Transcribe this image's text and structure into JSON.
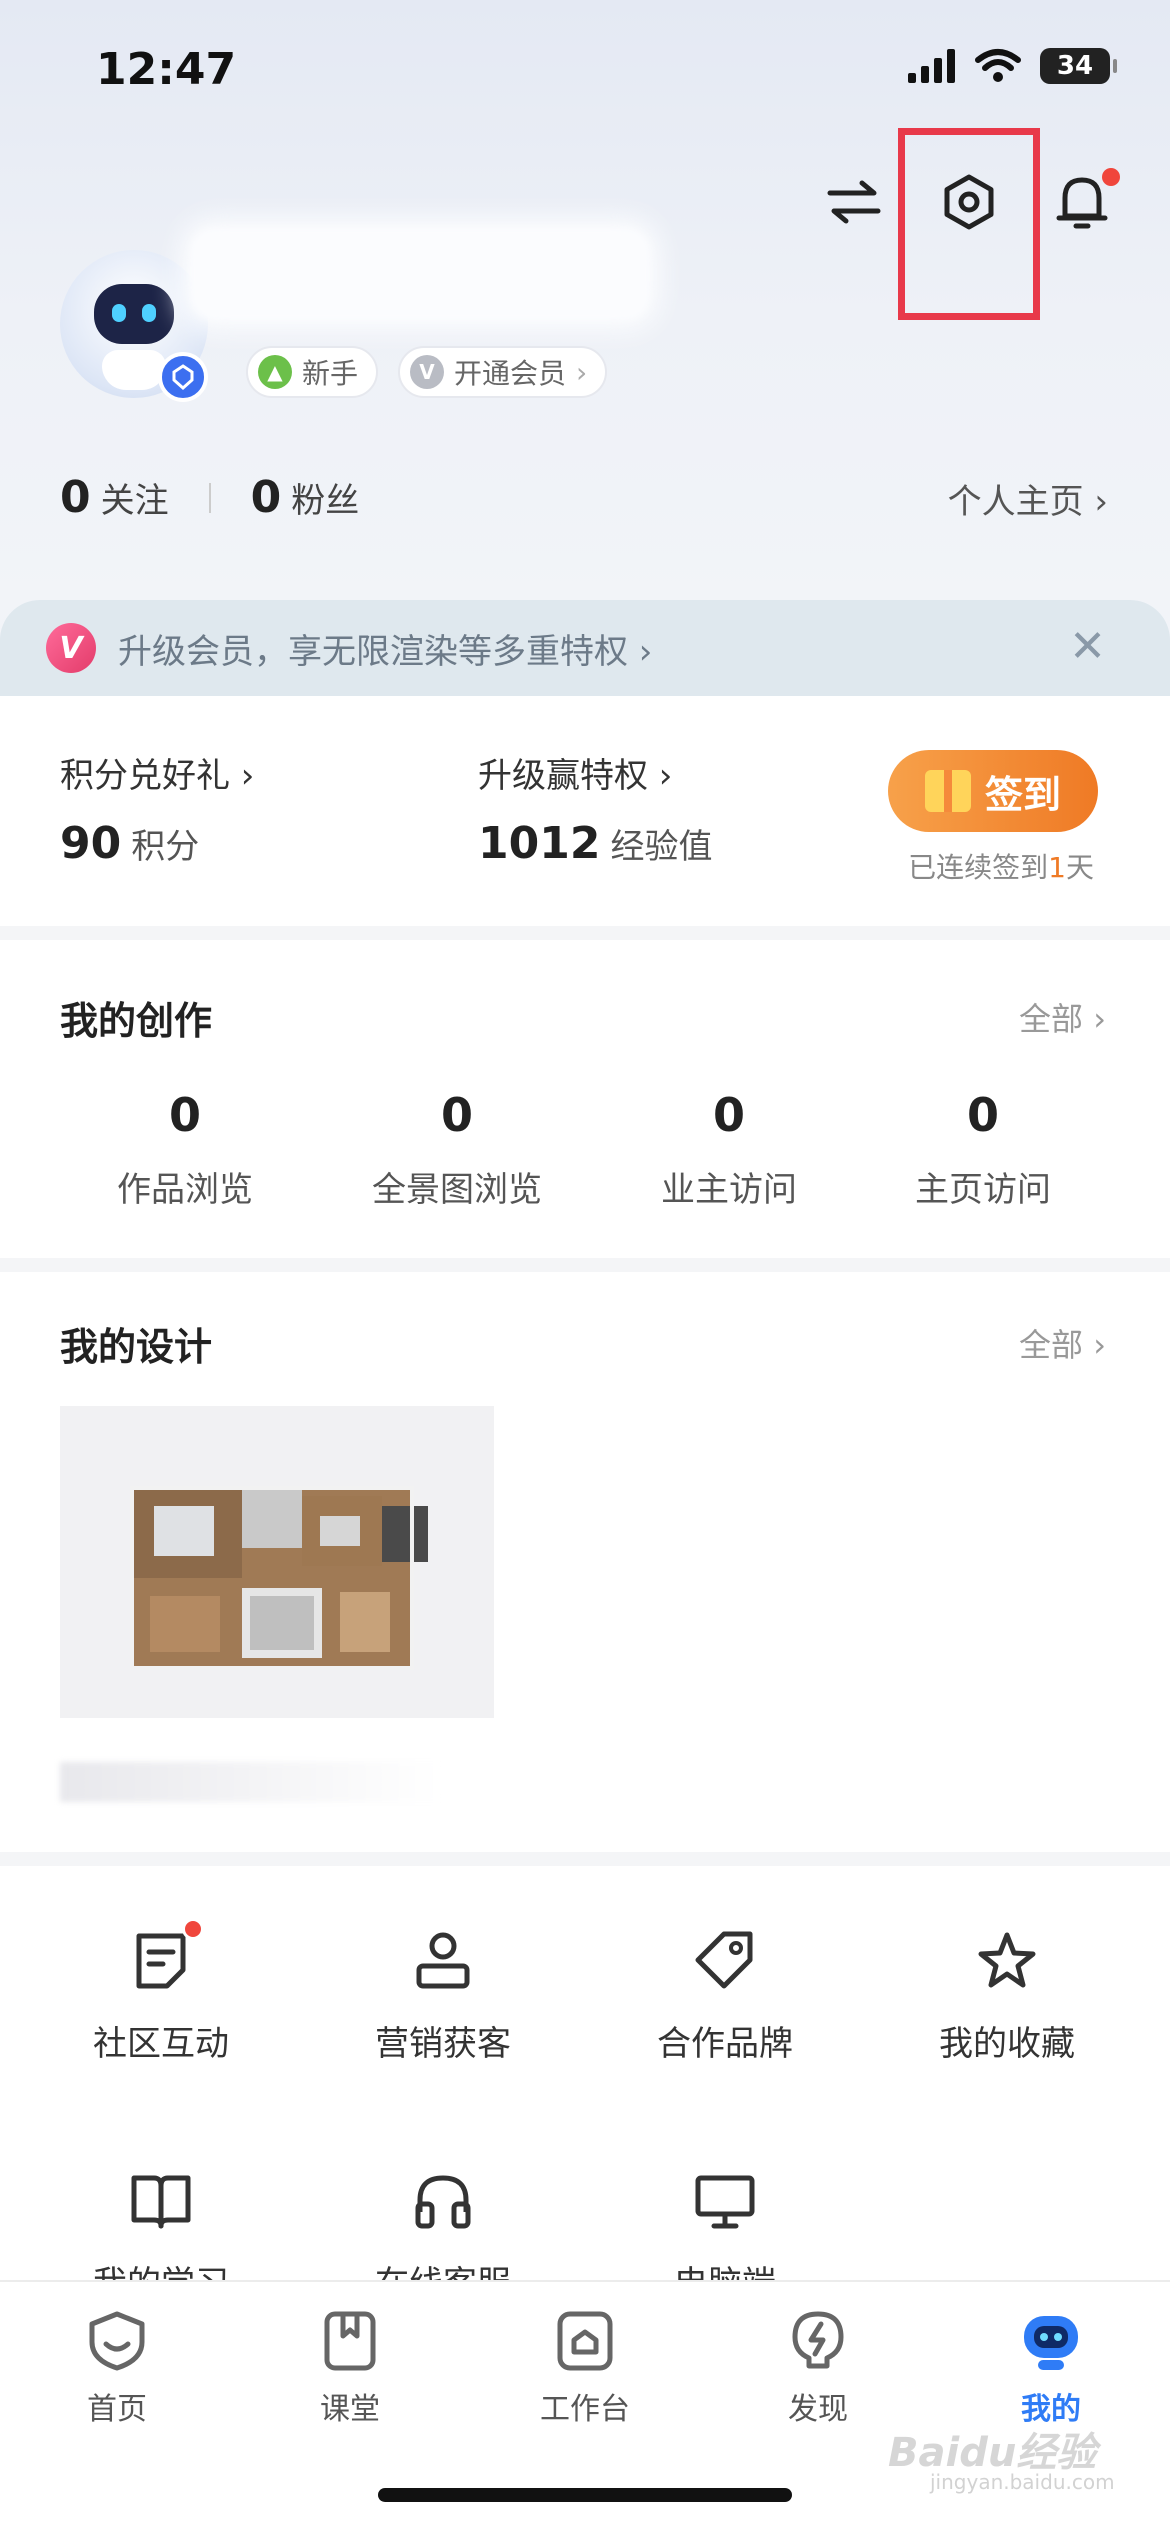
{
  "status_bar": {
    "time": "12:47",
    "battery": "34"
  },
  "profile": {
    "tags": [
      {
        "label": "新手",
        "icon": "leaf-icon",
        "color": "#6cc04a"
      },
      {
        "label": "开通会员",
        "icon": "v-icon",
        "color": "#b9bcc4",
        "chevron": "›"
      }
    ],
    "following_count": "0",
    "following_label": "关注",
    "followers_count": "0",
    "followers_label": "粉丝",
    "homepage_link": "个人主页 ›"
  },
  "member_banner": {
    "badge": "V",
    "text": "升级会员，享无限渲染等多重特权 ›",
    "close": "✕"
  },
  "points": {
    "redeem_label": "积分兑好礼 ›",
    "points_value": "90",
    "points_unit": "积分",
    "upgrade_label": "升级赢特权 ›",
    "exp_value": "1012",
    "exp_unit": "经验值",
    "signin_button": "签到",
    "signin_note_prefix": "已连续签到",
    "signin_days": "1",
    "signin_note_suffix": "天"
  },
  "creation": {
    "title": "我的创作",
    "see_all": "全部 ›",
    "stats": [
      {
        "value": "0",
        "label": "作品浏览"
      },
      {
        "value": "0",
        "label": "全景图浏览"
      },
      {
        "value": "0",
        "label": "业主访问"
      },
      {
        "value": "0",
        "label": "主页访问"
      }
    ]
  },
  "design": {
    "title": "我的设计",
    "see_all": "全部 ›"
  },
  "services": [
    {
      "label": "社区互动",
      "icon": "note-icon",
      "badge": true
    },
    {
      "label": "营销获客",
      "icon": "person-icon"
    },
    {
      "label": "合作品牌",
      "icon": "tag-icon"
    },
    {
      "label": "我的收藏",
      "icon": "star-icon"
    },
    {
      "label": "我的学习",
      "icon": "book-icon"
    },
    {
      "label": "在线客服",
      "icon": "headset-icon"
    },
    {
      "label": "电脑端",
      "icon": "monitor-icon"
    }
  ],
  "tabbar": [
    {
      "label": "首页",
      "icon": "home-shield-icon"
    },
    {
      "label": "课堂",
      "icon": "bookmark-icon"
    },
    {
      "label": "工作台",
      "icon": "workbench-icon"
    },
    {
      "label": "发现",
      "icon": "lightning-icon"
    },
    {
      "label": "我的",
      "icon": "robot-icon",
      "active": true
    }
  ],
  "colors": {
    "accent": "#2f7cf6",
    "signin": "#ef7a25",
    "highlight": "#e8394a",
    "badge_red": "#f0463c"
  },
  "watermark": {
    "main": "Baidu经验",
    "sub": "jingyan.baidu.com"
  }
}
